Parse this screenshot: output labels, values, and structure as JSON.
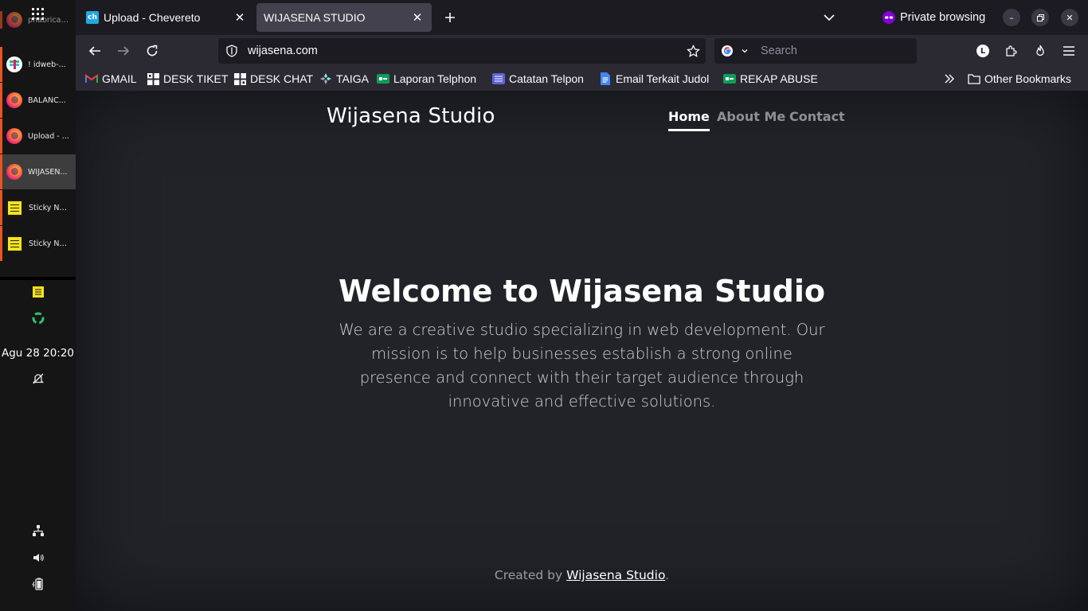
{
  "taskbar": {
    "items": [
      {
        "label": "phabricator",
        "icon": "firefox-icon"
      },
      {
        "label": "! idweb-...",
        "icon": "slack-icon"
      },
      {
        "label": "BALANC...",
        "icon": "firefox-icon"
      },
      {
        "label": "Upload - ...",
        "icon": "firefox-icon"
      },
      {
        "label": "WIJASEN...",
        "icon": "firefox-icon"
      },
      {
        "label": "Sticky No...",
        "icon": "sticky-notes-icon"
      },
      {
        "label": "Sticky No...",
        "icon": "sticky-notes-icon"
      }
    ],
    "clock": "Agu 28  20:20",
    "accent": "#e95420"
  },
  "tabs": [
    {
      "title": "Upload - Chevereto",
      "favicon": "ch"
    },
    {
      "title": "WIJASENA STUDIO"
    }
  ],
  "window": {
    "private_label": "Private browsing"
  },
  "navbar": {
    "url": "wijasena.com",
    "search_placeholder": "Search",
    "profile_letter": "L"
  },
  "bookmarks": {
    "items": [
      {
        "label": "GMAIL"
      },
      {
        "label": "DESK TIKET"
      },
      {
        "label": "DESK CHAT"
      },
      {
        "label": "TAIGA"
      },
      {
        "label": "Laporan Telphon"
      },
      {
        "label": "Catatan Telpon"
      },
      {
        "label": "Email Terkait Judol"
      },
      {
        "label": "REKAP ABUSE"
      }
    ],
    "other": "Other Bookmarks"
  },
  "site": {
    "title": "Wijasena Studio",
    "nav": [
      "Home",
      "About Me",
      "Contact"
    ],
    "hero_heading": "Welcome to Wijasena Studio",
    "hero_text": "We are a creative studio specializing in web development. Our mission is to help businesses establish a strong online presence and connect with their target audience through innovative and effective solutions.",
    "footer_prefix": "Created by ",
    "footer_link": "Wijasena Studio",
    "footer_suffix": ".",
    "background": "#212328"
  }
}
